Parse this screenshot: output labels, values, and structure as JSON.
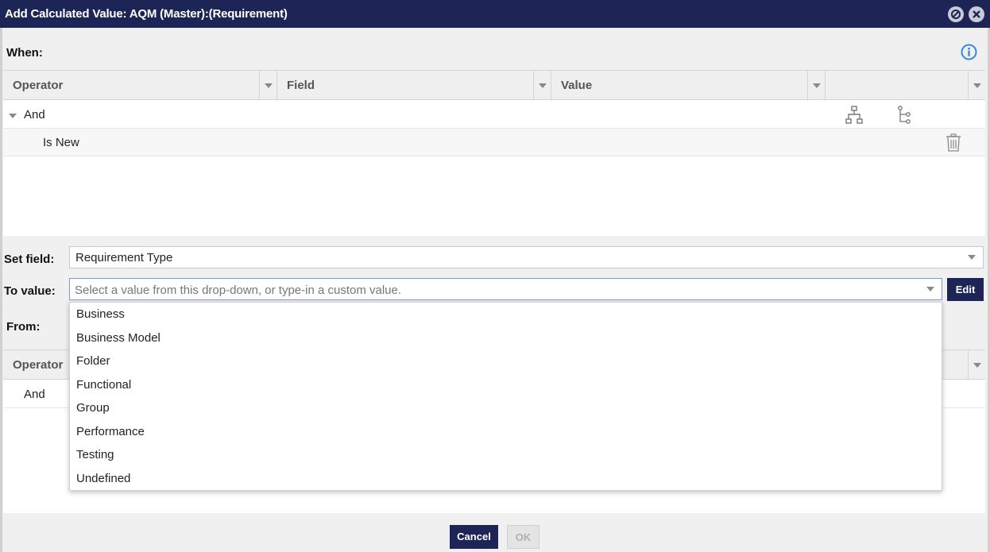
{
  "window": {
    "title": "Add Calculated Value: AQM (Master):(Requirement)",
    "icons": [
      "minimize-icon",
      "close-icon"
    ]
  },
  "when": {
    "label": "When:",
    "info_icon": "info-icon",
    "columns": [
      "Operator",
      "Field",
      "Value",
      ""
    ],
    "rows": [
      {
        "text": "And",
        "expanded": true
      },
      {
        "text": "Is New"
      }
    ]
  },
  "set_field": {
    "label": "Set field:",
    "value": "Requirement Type"
  },
  "to_value": {
    "label": "To value:",
    "placeholder": "Select a value from this drop-down, or type-in a custom value.",
    "edit_label": "Edit",
    "options": [
      "Business",
      "Business Model",
      "Folder",
      "Functional",
      "Group",
      "Performance",
      "Testing",
      "Undefined"
    ]
  },
  "from": {
    "label": "From:",
    "columns": [
      "Operator"
    ],
    "rows": [
      {
        "text": "And"
      }
    ]
  },
  "footer": {
    "cancel_label": "Cancel",
    "ok_label": "OK"
  },
  "colors": {
    "titlebar": "#1d2557",
    "primary_button": "#1d2557",
    "info_icon": "#3a8ad6"
  }
}
